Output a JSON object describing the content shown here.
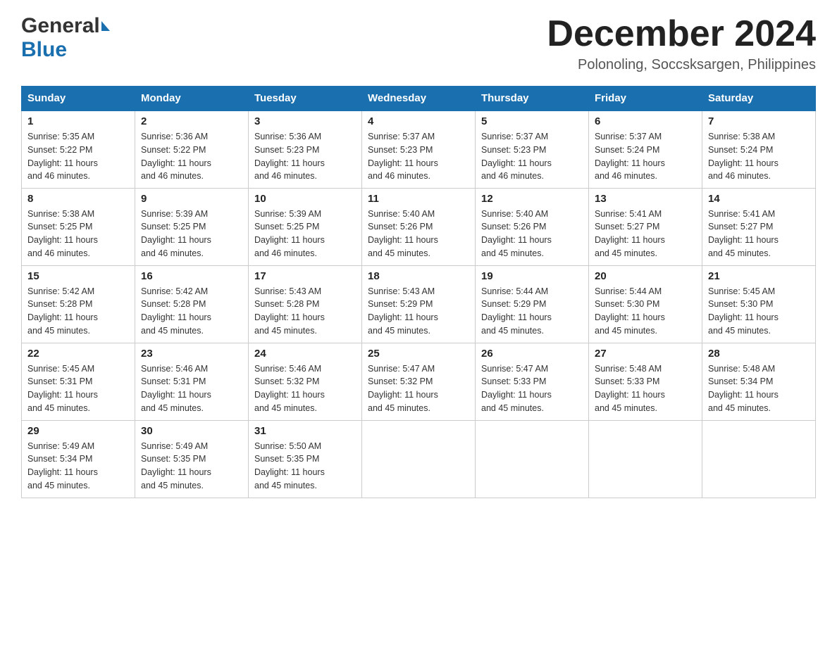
{
  "header": {
    "logo_general": "General",
    "logo_blue": "Blue",
    "title": "December 2024",
    "subtitle": "Polonoling, Soccsksargen, Philippines"
  },
  "days_of_week": [
    "Sunday",
    "Monday",
    "Tuesday",
    "Wednesday",
    "Thursday",
    "Friday",
    "Saturday"
  ],
  "weeks": [
    [
      {
        "day": "1",
        "sunrise": "5:35 AM",
        "sunset": "5:22 PM",
        "daylight": "11 hours and 46 minutes."
      },
      {
        "day": "2",
        "sunrise": "5:36 AM",
        "sunset": "5:22 PM",
        "daylight": "11 hours and 46 minutes."
      },
      {
        "day": "3",
        "sunrise": "5:36 AM",
        "sunset": "5:23 PM",
        "daylight": "11 hours and 46 minutes."
      },
      {
        "day": "4",
        "sunrise": "5:37 AM",
        "sunset": "5:23 PM",
        "daylight": "11 hours and 46 minutes."
      },
      {
        "day": "5",
        "sunrise": "5:37 AM",
        "sunset": "5:23 PM",
        "daylight": "11 hours and 46 minutes."
      },
      {
        "day": "6",
        "sunrise": "5:37 AM",
        "sunset": "5:24 PM",
        "daylight": "11 hours and 46 minutes."
      },
      {
        "day": "7",
        "sunrise": "5:38 AM",
        "sunset": "5:24 PM",
        "daylight": "11 hours and 46 minutes."
      }
    ],
    [
      {
        "day": "8",
        "sunrise": "5:38 AM",
        "sunset": "5:25 PM",
        "daylight": "11 hours and 46 minutes."
      },
      {
        "day": "9",
        "sunrise": "5:39 AM",
        "sunset": "5:25 PM",
        "daylight": "11 hours and 46 minutes."
      },
      {
        "day": "10",
        "sunrise": "5:39 AM",
        "sunset": "5:25 PM",
        "daylight": "11 hours and 46 minutes."
      },
      {
        "day": "11",
        "sunrise": "5:40 AM",
        "sunset": "5:26 PM",
        "daylight": "11 hours and 45 minutes."
      },
      {
        "day": "12",
        "sunrise": "5:40 AM",
        "sunset": "5:26 PM",
        "daylight": "11 hours and 45 minutes."
      },
      {
        "day": "13",
        "sunrise": "5:41 AM",
        "sunset": "5:27 PM",
        "daylight": "11 hours and 45 minutes."
      },
      {
        "day": "14",
        "sunrise": "5:41 AM",
        "sunset": "5:27 PM",
        "daylight": "11 hours and 45 minutes."
      }
    ],
    [
      {
        "day": "15",
        "sunrise": "5:42 AM",
        "sunset": "5:28 PM",
        "daylight": "11 hours and 45 minutes."
      },
      {
        "day": "16",
        "sunrise": "5:42 AM",
        "sunset": "5:28 PM",
        "daylight": "11 hours and 45 minutes."
      },
      {
        "day": "17",
        "sunrise": "5:43 AM",
        "sunset": "5:28 PM",
        "daylight": "11 hours and 45 minutes."
      },
      {
        "day": "18",
        "sunrise": "5:43 AM",
        "sunset": "5:29 PM",
        "daylight": "11 hours and 45 minutes."
      },
      {
        "day": "19",
        "sunrise": "5:44 AM",
        "sunset": "5:29 PM",
        "daylight": "11 hours and 45 minutes."
      },
      {
        "day": "20",
        "sunrise": "5:44 AM",
        "sunset": "5:30 PM",
        "daylight": "11 hours and 45 minutes."
      },
      {
        "day": "21",
        "sunrise": "5:45 AM",
        "sunset": "5:30 PM",
        "daylight": "11 hours and 45 minutes."
      }
    ],
    [
      {
        "day": "22",
        "sunrise": "5:45 AM",
        "sunset": "5:31 PM",
        "daylight": "11 hours and 45 minutes."
      },
      {
        "day": "23",
        "sunrise": "5:46 AM",
        "sunset": "5:31 PM",
        "daylight": "11 hours and 45 minutes."
      },
      {
        "day": "24",
        "sunrise": "5:46 AM",
        "sunset": "5:32 PM",
        "daylight": "11 hours and 45 minutes."
      },
      {
        "day": "25",
        "sunrise": "5:47 AM",
        "sunset": "5:32 PM",
        "daylight": "11 hours and 45 minutes."
      },
      {
        "day": "26",
        "sunrise": "5:47 AM",
        "sunset": "5:33 PM",
        "daylight": "11 hours and 45 minutes."
      },
      {
        "day": "27",
        "sunrise": "5:48 AM",
        "sunset": "5:33 PM",
        "daylight": "11 hours and 45 minutes."
      },
      {
        "day": "28",
        "sunrise": "5:48 AM",
        "sunset": "5:34 PM",
        "daylight": "11 hours and 45 minutes."
      }
    ],
    [
      {
        "day": "29",
        "sunrise": "5:49 AM",
        "sunset": "5:34 PM",
        "daylight": "11 hours and 45 minutes."
      },
      {
        "day": "30",
        "sunrise": "5:49 AM",
        "sunset": "5:35 PM",
        "daylight": "11 hours and 45 minutes."
      },
      {
        "day": "31",
        "sunrise": "5:50 AM",
        "sunset": "5:35 PM",
        "daylight": "11 hours and 45 minutes."
      },
      null,
      null,
      null,
      null
    ]
  ]
}
